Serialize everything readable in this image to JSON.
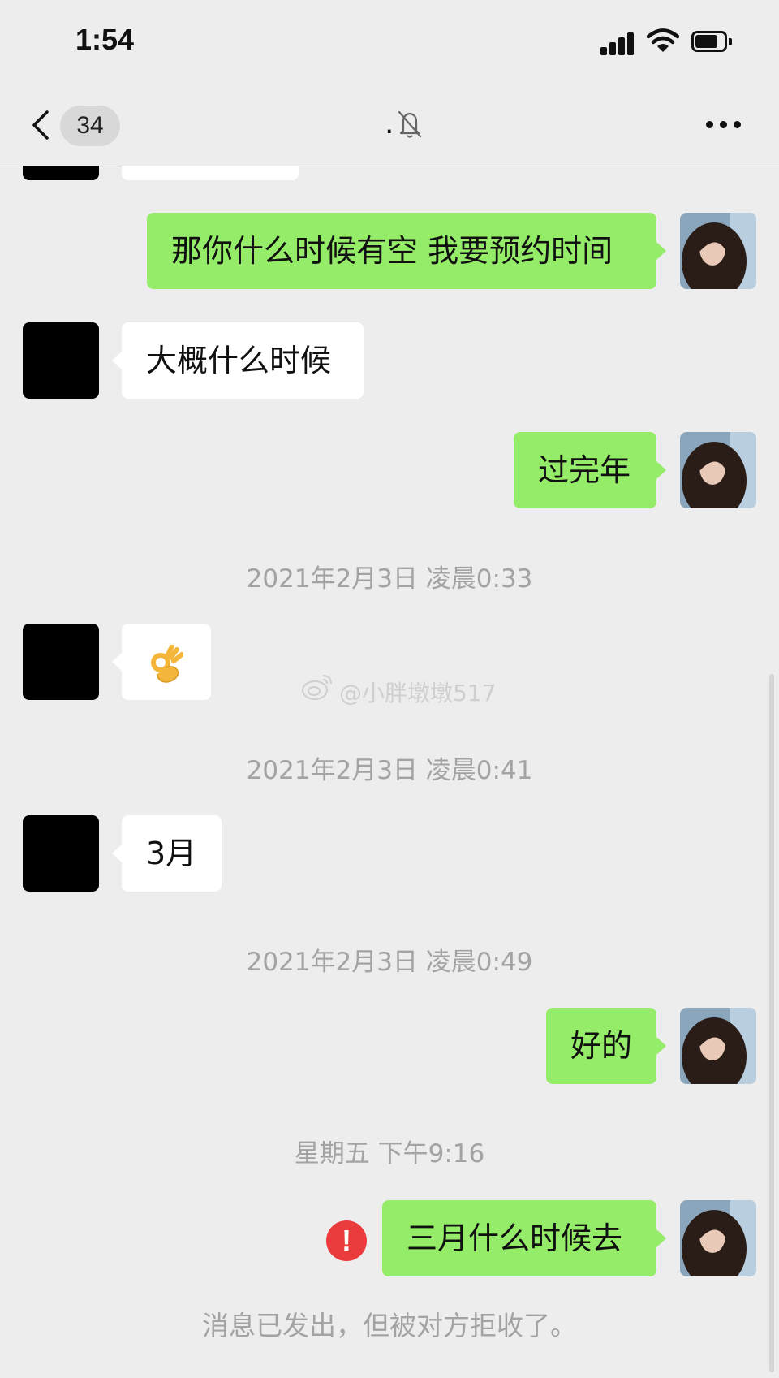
{
  "status_bar": {
    "time": "1:54",
    "signal_icon": "cellular-signal-icon",
    "wifi_icon": "wifi-icon",
    "battery_icon": "battery-icon"
  },
  "nav": {
    "back_icon": "chevron-left-icon",
    "unread_count": "34",
    "title": ".",
    "mute_icon": "bell-slash-icon",
    "more_icon": "more-dots-icon"
  },
  "messages": [
    {
      "side": "right",
      "text": "那你什么时候有空 我要预约时间"
    },
    {
      "side": "left",
      "text": "大概什么时候"
    },
    {
      "side": "right",
      "text": "过完年"
    },
    {
      "type": "timestamp",
      "text": "2021年2月3日 凌晨0:33"
    },
    {
      "side": "left",
      "emoji": "ok-hand-emoji"
    },
    {
      "type": "timestamp",
      "text": "2021年2月3日 凌晨0:41"
    },
    {
      "side": "left",
      "text": "3月"
    },
    {
      "type": "timestamp",
      "text": "2021年2月3日 凌晨0:49"
    },
    {
      "side": "right",
      "text": "好的"
    },
    {
      "type": "timestamp",
      "text": "星期五 下午9:16"
    },
    {
      "side": "right",
      "text": "三月什么时候去",
      "status": "error"
    }
  ],
  "error_mark": "!",
  "watermark": "@小胖墩墩517",
  "system_notice": "消息已发出，但被对方拒收了。",
  "colors": {
    "background": "#ededed",
    "sent_bubble": "#95ec69",
    "received_bubble": "#ffffff",
    "error": "#e93b3b",
    "timestamp_text": "#a3a3a3"
  }
}
